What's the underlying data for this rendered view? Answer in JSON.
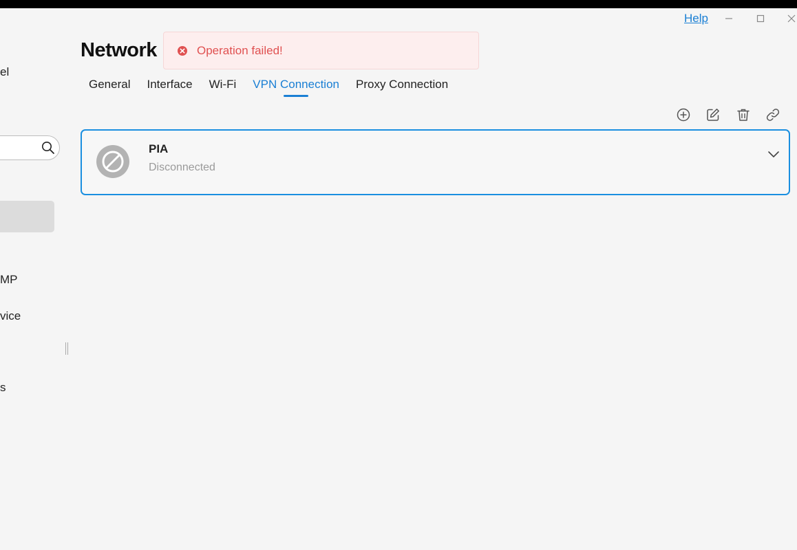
{
  "window": {
    "help_label": "Help"
  },
  "sidebar": {
    "partial_items": [
      {
        "label": "el"
      },
      {
        "label": "MP"
      },
      {
        "label": "vice"
      },
      {
        "label": "s"
      }
    ]
  },
  "page": {
    "title": "Network"
  },
  "toast": {
    "message": "Operation failed!",
    "color": "#e05151"
  },
  "tabs": [
    {
      "label": "General"
    },
    {
      "label": "Interface"
    },
    {
      "label": "Wi-Fi"
    },
    {
      "label": "VPN Connection",
      "active": true
    },
    {
      "label": "Proxy Connection"
    }
  ],
  "toolbar": {
    "icons": [
      "add-icon",
      "edit-icon",
      "delete-icon",
      "link-icon"
    ]
  },
  "vpn_connections": [
    {
      "name": "PIA",
      "status": "Disconnected",
      "icon": "disconnected-icon"
    }
  ],
  "colors": {
    "accent": "#1a7fd4",
    "error": "#e05151"
  }
}
